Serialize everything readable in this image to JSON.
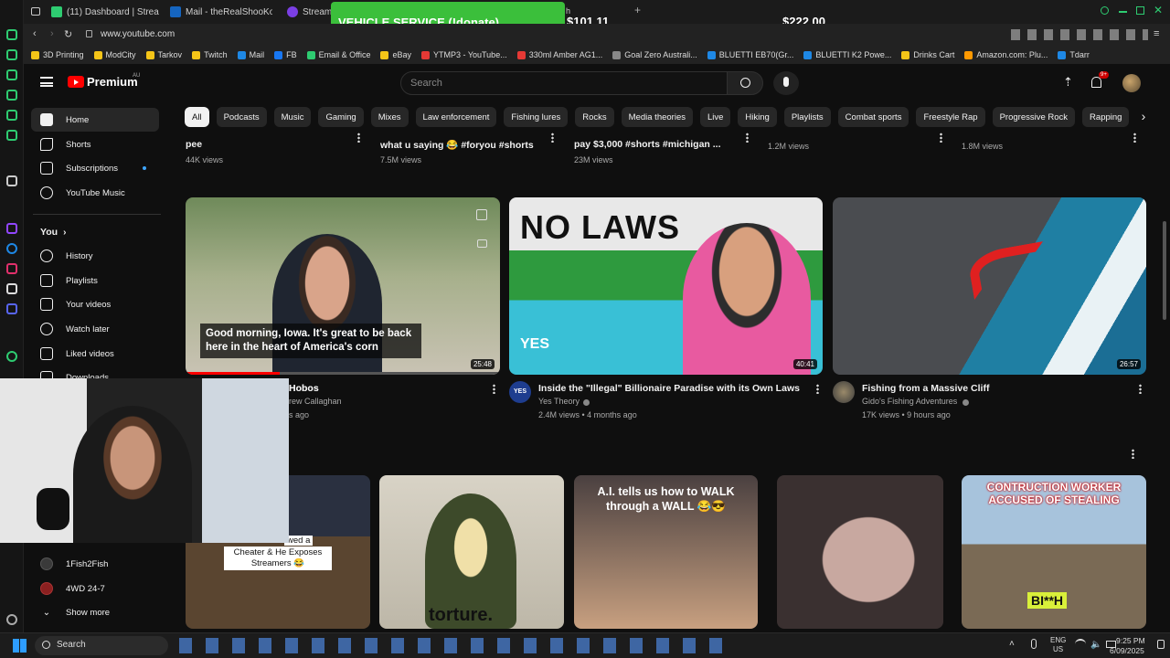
{
  "browser": {
    "tabs": [
      {
        "label": "(11) Dashboard | Streamla",
        "color": "#2ecc71"
      },
      {
        "label": "Mail - theRealShooKon3",
        "color": "#1565c0"
      },
      {
        "label": "StreamEl",
        "color": "#7b3fe4"
      }
    ],
    "url": "www.youtube.com",
    "bookmarks": [
      {
        "label": "3D Printing",
        "color": "#f5c518"
      },
      {
        "label": "ModCity",
        "color": "#f5c518"
      },
      {
        "label": "Tarkov",
        "color": "#f5c518"
      },
      {
        "label": "Twitch",
        "color": "#f5c518"
      },
      {
        "label": "Mail",
        "color": "#1e88e5"
      },
      {
        "label": "FB",
        "color": "#1877f2"
      },
      {
        "label": "Email & Office",
        "color": "#2ecc71"
      },
      {
        "label": "eBay",
        "color": "#f5c518"
      },
      {
        "label": "YTMP3 - YouTube...",
        "color": "#e53935"
      },
      {
        "label": "330ml Amber AG1...",
        "color": "#e53935"
      },
      {
        "label": "Goal Zero Australi...",
        "color": "#888888"
      },
      {
        "label": "BLUETTI EB70(Gr...",
        "color": "#1e88e5"
      },
      {
        "label": "BLUETTI K2 Powe...",
        "color": "#1e88e5"
      },
      {
        "label": "Drinks Cart",
        "color": "#f5c518"
      },
      {
        "label": "Amazon.com: Plu...",
        "color": "#ff9900"
      },
      {
        "label": "Tdarr",
        "color": "#1e88e5"
      }
    ]
  },
  "overlay": {
    "donate_label": "VEHICLE SERVICE (!donate)",
    "amount_1": "$101.11",
    "amount_2": "$222.00",
    "webcam_caption": "Hobos"
  },
  "youtube": {
    "logo": "Premium",
    "region": "AU",
    "search_placeholder": "Search",
    "notification_count": "9+",
    "chips": [
      "All",
      "Podcasts",
      "Music",
      "Gaming",
      "Mixes",
      "Law enforcement",
      "Fishing lures",
      "Rocks",
      "Media theories",
      "Live",
      "Hiking",
      "Playlists",
      "Combat sports",
      "Freestyle Rap",
      "Progressive Rock",
      "Rapping"
    ],
    "sidebar": {
      "main": [
        "Home",
        "Shorts",
        "Subscriptions",
        "YouTube Music"
      ],
      "you_header": "You",
      "you": [
        "History",
        "Playlists",
        "Your videos",
        "Watch later",
        "Liked videos",
        "Downloads"
      ],
      "subs": [
        "1Fish2Fish",
        "4WD 24-7"
      ],
      "show_more": "Show more"
    },
    "top_row": [
      {
        "title_tail": "pee",
        "views": "44K views"
      },
      {
        "title_tail": "what u saying 😂 #foryou #shorts",
        "views": "7.5M views"
      },
      {
        "title_tail": "pay $3,000 #shorts #michigan ...",
        "views": "23M views"
      },
      {
        "title_tail": "",
        "views": "1.2M views"
      },
      {
        "title_tail": "",
        "views": "1.8M views"
      }
    ],
    "videos": [
      {
        "title": "Hobos",
        "channel": "rew Callaghan",
        "meta": "s ago",
        "duration": "25:48",
        "caption": "Good morning, Iowa. It's great to be back here in the heart of America's corn"
      },
      {
        "title": "Inside the \"Illegal\" Billionaire Paradise with its Own Laws",
        "channel": "Yes Theory",
        "meta": "2.4M views • 4 months ago",
        "duration": "40:41",
        "overlay": "NO LAWS",
        "badge": "YES"
      },
      {
        "title": "Fishing from a Massive Cliff",
        "channel": "Gido's Fishing Adventures",
        "meta": "17K views • 9 hours ago",
        "duration": "26:57"
      }
    ],
    "shorts": [
      {
        "caption": "Cheater & He Exposes Streamers 😂",
        "caption_pre": "wed a"
      },
      {
        "caption": "torture."
      },
      {
        "caption": "A.I. tells us how to WALK through a WALL 😂😎"
      },
      {
        "caption": ""
      },
      {
        "caption": "CONTRUCTION WORKER ACCUSED OF STEALING",
        "badge": "BI**H"
      }
    ]
  },
  "taskbar": {
    "search": "Search",
    "lang": "ENG",
    "region": "US",
    "time": "9:25 PM",
    "date": "6/09/2025"
  }
}
